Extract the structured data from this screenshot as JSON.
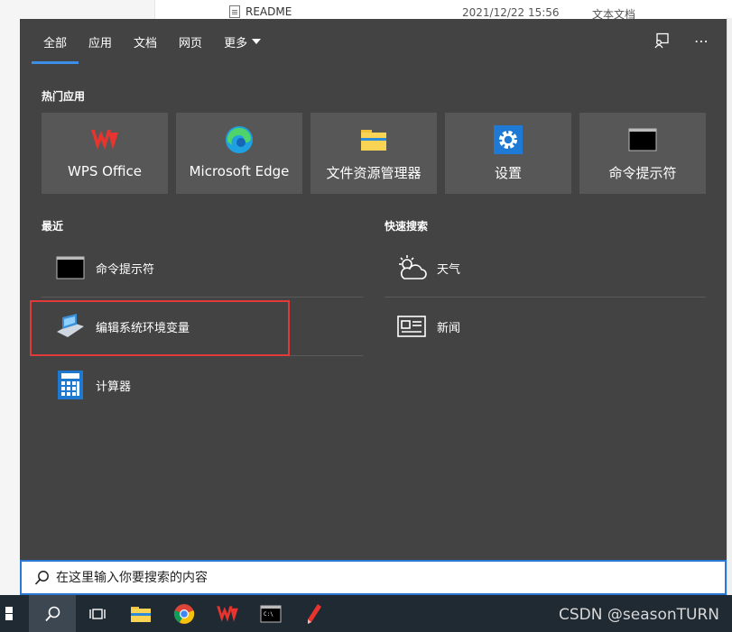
{
  "background_window": {
    "file_name": "README",
    "file_date": "2021/12/22 15:56",
    "file_type": "文本文档"
  },
  "tabs": [
    {
      "label": "全部",
      "active": true
    },
    {
      "label": "应用"
    },
    {
      "label": "文档"
    },
    {
      "label": "网页"
    },
    {
      "label": "更多"
    }
  ],
  "header_icons": {
    "feedback": "feedback-icon",
    "more": "⋯"
  },
  "hot_apps": {
    "title": "热门应用",
    "items": [
      {
        "label": "WPS Office",
        "icon": "wps-icon"
      },
      {
        "label": "Microsoft Edge",
        "icon": "edge-icon"
      },
      {
        "label": "文件资源管理器",
        "icon": "file-explorer-icon"
      },
      {
        "label": "设置",
        "icon": "settings-icon"
      },
      {
        "label": "命令提示符",
        "icon": "cmd-icon"
      }
    ]
  },
  "recent": {
    "title": "最近",
    "items": [
      {
        "label": "命令提示符",
        "icon": "cmd-icon"
      },
      {
        "label": "编辑系统环境变量",
        "icon": "system-properties-icon"
      },
      {
        "label": "计算器",
        "icon": "calculator-icon"
      }
    ]
  },
  "quick_search": {
    "title": "快速搜索",
    "items": [
      {
        "label": "天气",
        "icon": "weather-icon"
      },
      {
        "label": "新闻",
        "icon": "news-icon"
      }
    ]
  },
  "search": {
    "placeholder": "在这里输入你要搜索的内容"
  },
  "watermark": "CSDN @seasonTURN",
  "colors": {
    "panel": "#434343",
    "tile": "#575757",
    "accent": "#3d8ee6",
    "highlight": "#e03a3a",
    "taskbar": "#202a33"
  }
}
